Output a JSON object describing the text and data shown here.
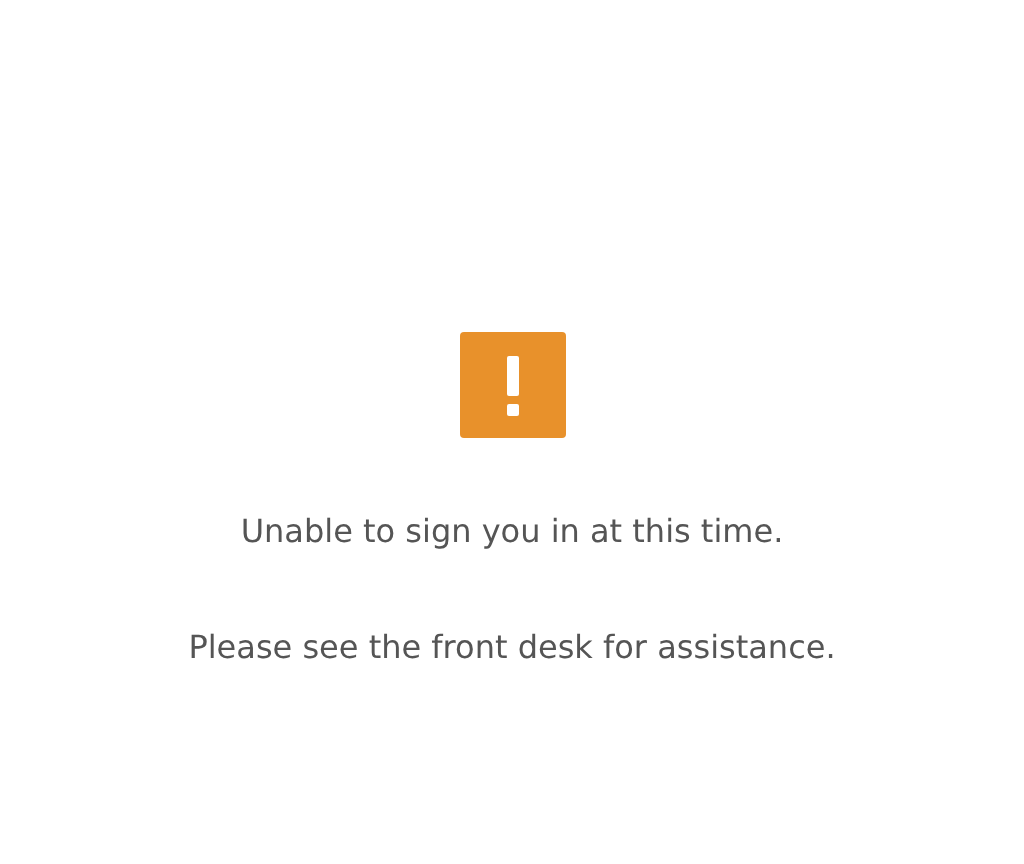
{
  "alert": {
    "kind": "warning",
    "messages": [
      "Unable to sign you in at this time.",
      "Please see the front desk for assistance."
    ]
  }
}
